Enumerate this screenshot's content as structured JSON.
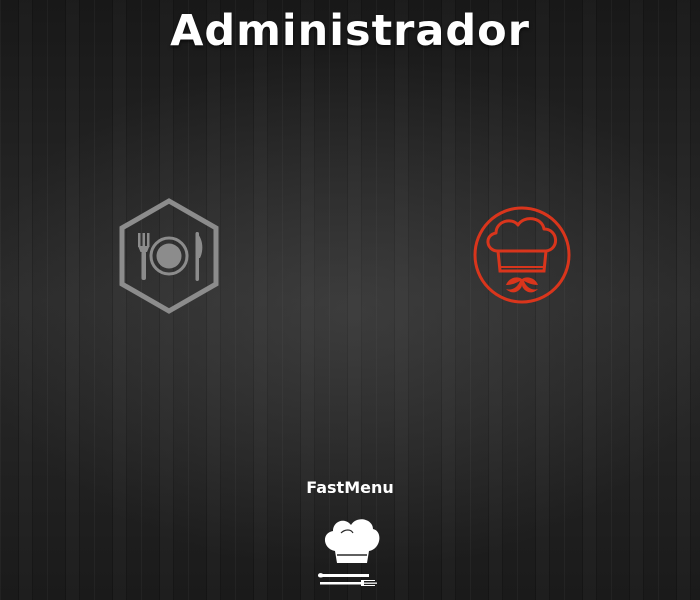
{
  "header": {
    "title": "Administrador"
  },
  "tiles": [
    {
      "name": "tile-restaurant",
      "icon": "plate-fork-knife-icon",
      "color": "#8c8c8c"
    },
    {
      "name": "tile-chef",
      "icon": "chef-hat-mustache-icon",
      "color": "#d9351c"
    }
  ],
  "footer": {
    "brand_name": "FastMenu",
    "logo_icon": "chef-hat-cutlery-icon"
  },
  "colors": {
    "background": "#1e1e1e",
    "text": "#ffffff",
    "accent": "#d9351c",
    "muted": "#8c8c8c"
  }
}
